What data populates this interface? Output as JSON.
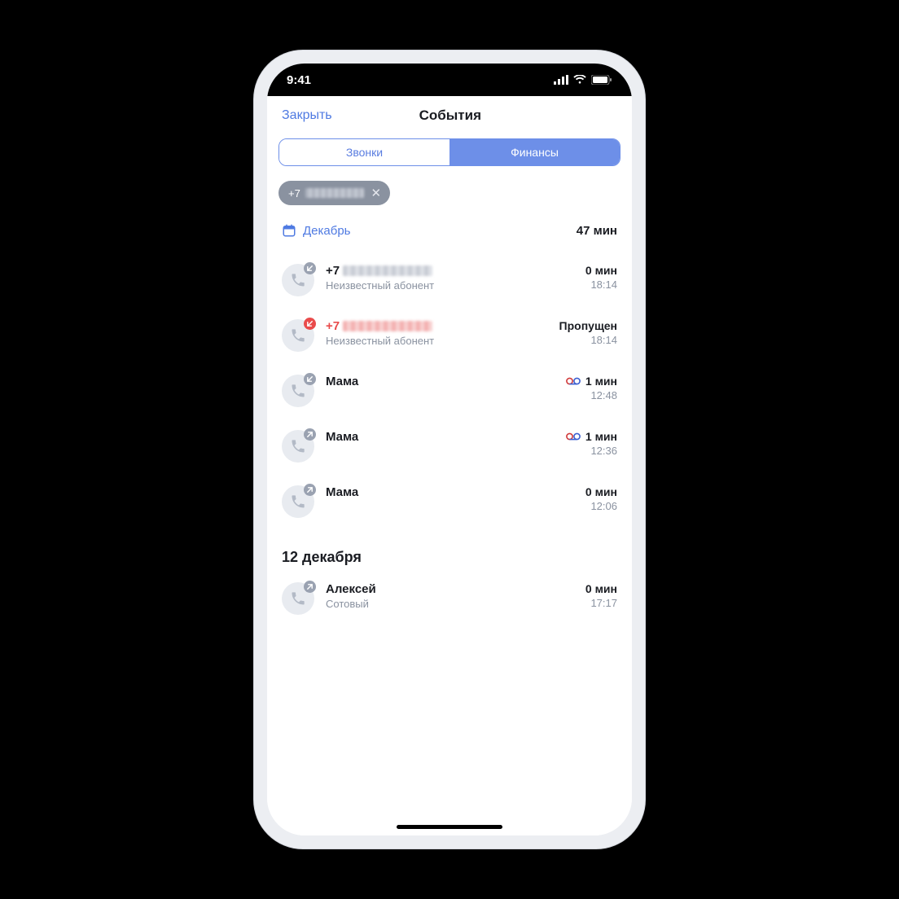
{
  "status": {
    "time": "9:41"
  },
  "header": {
    "close": "Закрыть",
    "title": "События"
  },
  "segments": {
    "calls": "Звонки",
    "finances": "Финансы"
  },
  "chip": {
    "prefix": "+7"
  },
  "month": {
    "label": "Декабрь",
    "total": "47 мин"
  },
  "calls": [
    {
      "type": "in",
      "title_prefix": "+7",
      "blurred": true,
      "sub": "Неизвестный абонент",
      "value": "0 мин",
      "time": "18:14",
      "voicemail": false,
      "missed": false
    },
    {
      "type": "miss",
      "title_prefix": "+7",
      "blurred": true,
      "sub": "Неизвестный абонент",
      "value": "Пропущен",
      "time": "18:14",
      "voicemail": false,
      "missed": true
    },
    {
      "type": "in",
      "title": "Мама",
      "sub": "",
      "value": "1 мин",
      "time": "12:48",
      "voicemail": true,
      "missed": false
    },
    {
      "type": "out",
      "title": "Мама",
      "sub": "",
      "value": "1 мин",
      "time": "12:36",
      "voicemail": true,
      "missed": false
    },
    {
      "type": "out",
      "title": "Мама",
      "sub": "",
      "value": "0 мин",
      "time": "12:06",
      "voicemail": false,
      "missed": false
    }
  ],
  "section2": {
    "header": "12 декабря"
  },
  "calls2": [
    {
      "type": "out",
      "title": "Алексей",
      "sub": "Сотовый",
      "value": "0 мин",
      "time": "17:17",
      "voicemail": false,
      "missed": false
    }
  ]
}
